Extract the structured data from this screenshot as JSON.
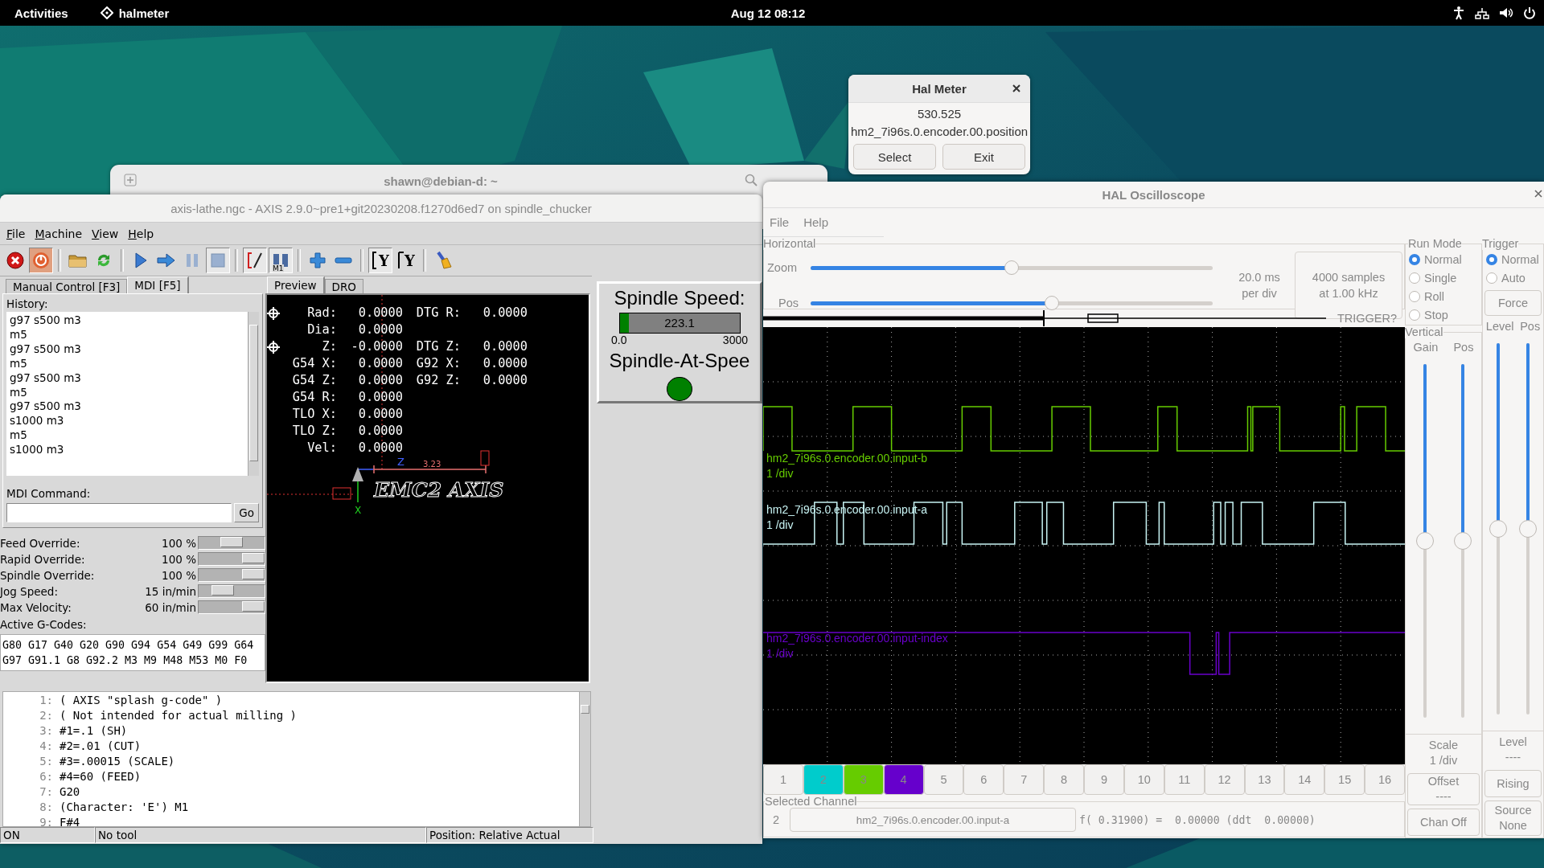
{
  "top_bar": {
    "activities": "Activities",
    "app": "halmeter",
    "clock": "Aug 12  08:12"
  },
  "terminal_window": {
    "title": "shawn@debian-d: ~"
  },
  "axis_window": {
    "title": "axis-lathe.ngc - AXIS 2.9.0~pre1+git20230208.f1270d6ed7 on spindle_chucker",
    "menu": [
      "File",
      "Machine",
      "View",
      "Help"
    ],
    "toolbar": [
      {
        "kind": "estop",
        "pressed": false
      },
      {
        "kind": "power",
        "pressed": true
      },
      {
        "kind": "open",
        "pressed": false
      },
      {
        "kind": "reload",
        "pressed": false
      },
      {
        "kind": "run",
        "pressed": false
      },
      {
        "kind": "step",
        "pressed": false
      },
      {
        "kind": "pause",
        "pressed": false
      },
      {
        "kind": "stop",
        "pressed": true
      },
      {
        "kind": "skip",
        "pressed": true
      },
      {
        "kind": "optional_stop",
        "label": "M1",
        "pressed": true
      },
      {
        "kind": "zoom_in",
        "pressed": false
      },
      {
        "kind": "zoom_out",
        "pressed": false
      },
      {
        "kind": "view",
        "label": "Y",
        "pressed": true
      },
      {
        "kind": "view_flip",
        "label": "Y",
        "pressed": false
      },
      {
        "kind": "clear",
        "pressed": false
      }
    ],
    "tabs": [
      {
        "label": "Manual Control [F3]",
        "selected": false
      },
      {
        "label": "MDI [F5]",
        "selected": true
      }
    ],
    "history_label": "History:",
    "history": [
      "g97 s500 m3",
      "m5",
      "g97 s500 m3",
      "m5",
      "g97 s500 m3",
      "m5",
      "g97 s500 m3",
      "s1000 m3",
      "m5",
      "s1000 m3"
    ],
    "mdi_label": "MDI Command:",
    "go_button": "Go",
    "overrides": [
      {
        "label": "Feed Override:",
        "value": "100 %",
        "level": 0.5
      },
      {
        "label": "Rapid Override:",
        "value": "100 %",
        "level": 1
      },
      {
        "label": "Spindle Override:",
        "value": "100 %",
        "level": 1
      },
      {
        "label": "Jog Speed:",
        "value": "15 in/min",
        "level": 0.3
      },
      {
        "label": "Max Velocity:",
        "value": "60 in/min",
        "level": 1
      }
    ],
    "active_gcodes_label": "Active G-Codes:",
    "active_gcodes": [
      "G80 G17 G40 G20 G90 G94 G54 G49 G99 G64",
      "G97 G91.1 G8 G92.2 M3 M9 M48 M53 M0 F0"
    ],
    "preview_tabs": [
      {
        "label": "Preview",
        "selected": true
      },
      {
        "label": "DRO",
        "selected": false
      }
    ],
    "dro": [
      {
        "homed": true,
        "label": "Rad:",
        "value": "0.0000",
        "label2": "DTG R:",
        "value2": "0.0000"
      },
      {
        "homed": false,
        "label": "Dia:",
        "value": "0.0000"
      },
      {
        "homed": true,
        "label": "Z:",
        "value": "-0.0000",
        "label2": "DTG Z:",
        "value2": "0.0000"
      },
      {
        "homed": false,
        "label": "G54 X:",
        "value": "0.0000",
        "label2": "G92 X:",
        "value2": "0.0000"
      },
      {
        "homed": false,
        "label": "G54 Z:",
        "value": "0.0000",
        "label2": "G92 Z:",
        "value2": "0.0000"
      },
      {
        "homed": false,
        "label": "G54 R:",
        "value": "0.0000"
      },
      {
        "homed": false,
        "label": "TLO X:",
        "value": "0.0000"
      },
      {
        "homed": false,
        "label": "TLO Z:",
        "value": "0.0000"
      },
      {
        "homed": false,
        "label": "Vel:",
        "value": "0.0000"
      }
    ],
    "preview_labels": {
      "path_text": "EMC2 AXIS",
      "z_axis": "Z",
      "x_axis": "X",
      "extent": "3.23"
    },
    "spindle": {
      "title": "Spindle Speed:",
      "reading": "223.1",
      "level": 0.074,
      "min": "0.0",
      "max": "3000",
      "at_speed_label": "Spindle-At-Spee",
      "at_speed_on": true
    },
    "gcode": [
      {
        "number": "1:",
        "text": "( AXIS \"splash g-code\" )"
      },
      {
        "number": "2:",
        "text": "( Not intended for actual milling )"
      },
      {
        "number": "3:",
        "text": "#1=.1 (SH)"
      },
      {
        "number": "4:",
        "text": "#2=.01 (CUT)"
      },
      {
        "number": "5:",
        "text": "#3=.00015 (SCALE)"
      },
      {
        "number": "6:",
        "text": "#4=60 (FEED)"
      },
      {
        "number": "7:",
        "text": "G20"
      },
      {
        "number": "8:",
        "text": "(Character: 'E') M1"
      },
      {
        "number": "9:",
        "text": "F#4"
      }
    ],
    "status_bar": [
      "ON",
      "No tool",
      "Position: Relative Actual"
    ]
  },
  "hal_meter": {
    "title": "Hal Meter",
    "value": "530.525",
    "pin": "hm2_7i96s.0.encoder.00.position",
    "buttons": [
      "Select",
      "Exit"
    ]
  },
  "scope": {
    "title": "HAL Oscilloscope",
    "menu": [
      "File",
      "Help"
    ],
    "horizontal": {
      "label": "Horizontal",
      "zoom_label": "Zoom",
      "zoom": {
        "level": 0.5
      },
      "pos_label": "Pos",
      "pos": {
        "level": 0.6
      },
      "rate": [
        "20.0 ms",
        "per div"
      ],
      "samples": [
        "4000 samples",
        "at 1.00 kHz"
      ]
    },
    "trigger_status": "TRIGGER?",
    "run_mode": {
      "label": "Run Mode",
      "options": [
        {
          "label": "Normal",
          "selected": true
        },
        {
          "label": "Single",
          "selected": false
        },
        {
          "label": "Roll",
          "selected": false
        },
        {
          "label": "Stop",
          "selected": false
        }
      ]
    },
    "vertical": {
      "label": "Vertical",
      "gain_label": "Gain",
      "pos_label": "Pos",
      "gain": {
        "level": 0.5
      },
      "pos": {
        "level": 0.5
      },
      "scale": [
        "Scale",
        "1 /div"
      ],
      "offset": [
        "Offset",
        "----"
      ],
      "chan_off": "Chan Off"
    },
    "trigger": {
      "label": "Trigger",
      "options": [
        {
          "label": "Normal",
          "selected": true
        },
        {
          "label": "Auto",
          "selected": false
        }
      ],
      "force": "Force",
      "level_label": "Level",
      "pos_label": "Pos",
      "level_slider": {
        "level": 0.5
      },
      "pos_slider": {
        "level": 0.5
      },
      "readout": [
        "Level",
        "----"
      ],
      "edge": "Rising",
      "source": [
        "Source",
        "None"
      ]
    },
    "traces": [
      {
        "name": "hm2_7i96s.0.encoder.00.input-b",
        "scale": "1 /div",
        "color": "#66cc00"
      },
      {
        "name": "hm2_7i96s.0.encoder.00.input-a",
        "scale": "1 /div",
        "color": "#c8f4f4"
      },
      {
        "name": "hm2_7i96s.0.encoder.00.input-index",
        "scale": "1 /div",
        "color": "#6a00cc"
      }
    ],
    "channels": [
      {
        "label": "1"
      },
      {
        "label": "2",
        "color": "#00cccc"
      },
      {
        "label": "3",
        "color": "#66cc00"
      },
      {
        "label": "4",
        "color": "#6600cc"
      },
      {
        "label": "5"
      },
      {
        "label": "6"
      },
      {
        "label": "7"
      },
      {
        "label": "8"
      },
      {
        "label": "9"
      },
      {
        "label": "10"
      },
      {
        "label": "11"
      },
      {
        "label": "12"
      },
      {
        "label": "13"
      },
      {
        "label": "14"
      },
      {
        "label": "15"
      },
      {
        "label": "16"
      }
    ],
    "selected_channel": {
      "label": "Selected Channel",
      "number": "2",
      "pin": "hm2_7i96s.0.encoder.00.input-a",
      "value": "f( 0.31900) =  0.00000 (ddt  0.00000)"
    }
  }
}
